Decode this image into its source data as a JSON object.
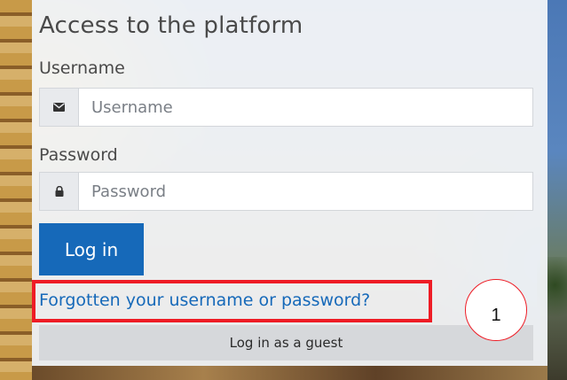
{
  "login_card": {
    "title": "Access to the platform",
    "username": {
      "label": "Username",
      "placeholder": "Username",
      "icon": "envelope-icon"
    },
    "password": {
      "label": "Password",
      "placeholder": "Password",
      "icon": "lock-icon"
    },
    "login_button_label": "Log in",
    "forgot_link_text": "Forgotten your username or password?",
    "guest_button_label": "Log in as a guest"
  },
  "annotation": {
    "callout_number": "1",
    "highlight_color": "#ee1c25"
  },
  "colors": {
    "primary": "#1669b9",
    "card_background": "#f4f6f9",
    "guest_button": "#d6d8db"
  }
}
